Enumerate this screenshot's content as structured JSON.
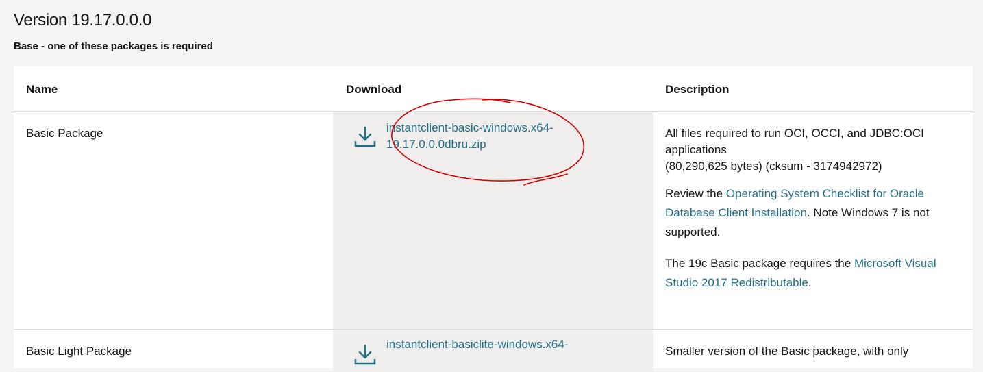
{
  "version_title": "Version 19.17.0.0.0",
  "section_subtitle": "Base - one of these packages is required",
  "table": {
    "headers": {
      "name": "Name",
      "download": "Download",
      "description": "Description"
    },
    "rows": [
      {
        "name": "Basic Package",
        "download_icon": "download-icon",
        "download_line1": "instantclient-basic-windows.x64-",
        "download_line2": "19.17.0.0.0dbru.zip",
        "desc_line1": "All files required to run OCI, OCCI, and JDBC:OCI",
        "desc_line2": "applications",
        "desc_line3": "(80,290,625 bytes) (cksum - 3174942972)",
        "review_prefix": "Review the ",
        "review_link": "Operating System Checklist for Oracle Database Client Installation",
        "review_suffix": ". Note Windows 7 is not supported.",
        "req_prefix": "The 19c Basic package requires the ",
        "req_link": "Microsoft Visual Studio 2017 Redistributable",
        "req_suffix": "."
      },
      {
        "name": "Basic Light Package",
        "download_icon": "download-icon",
        "download_line1": "instantclient-basiclite-windows.x64-",
        "desc_line1": "Smaller version of the Basic package, with only"
      }
    ]
  },
  "colors": {
    "link": "#227187",
    "annotation": "#d40000",
    "download_cell_bg": "#efeeec"
  }
}
